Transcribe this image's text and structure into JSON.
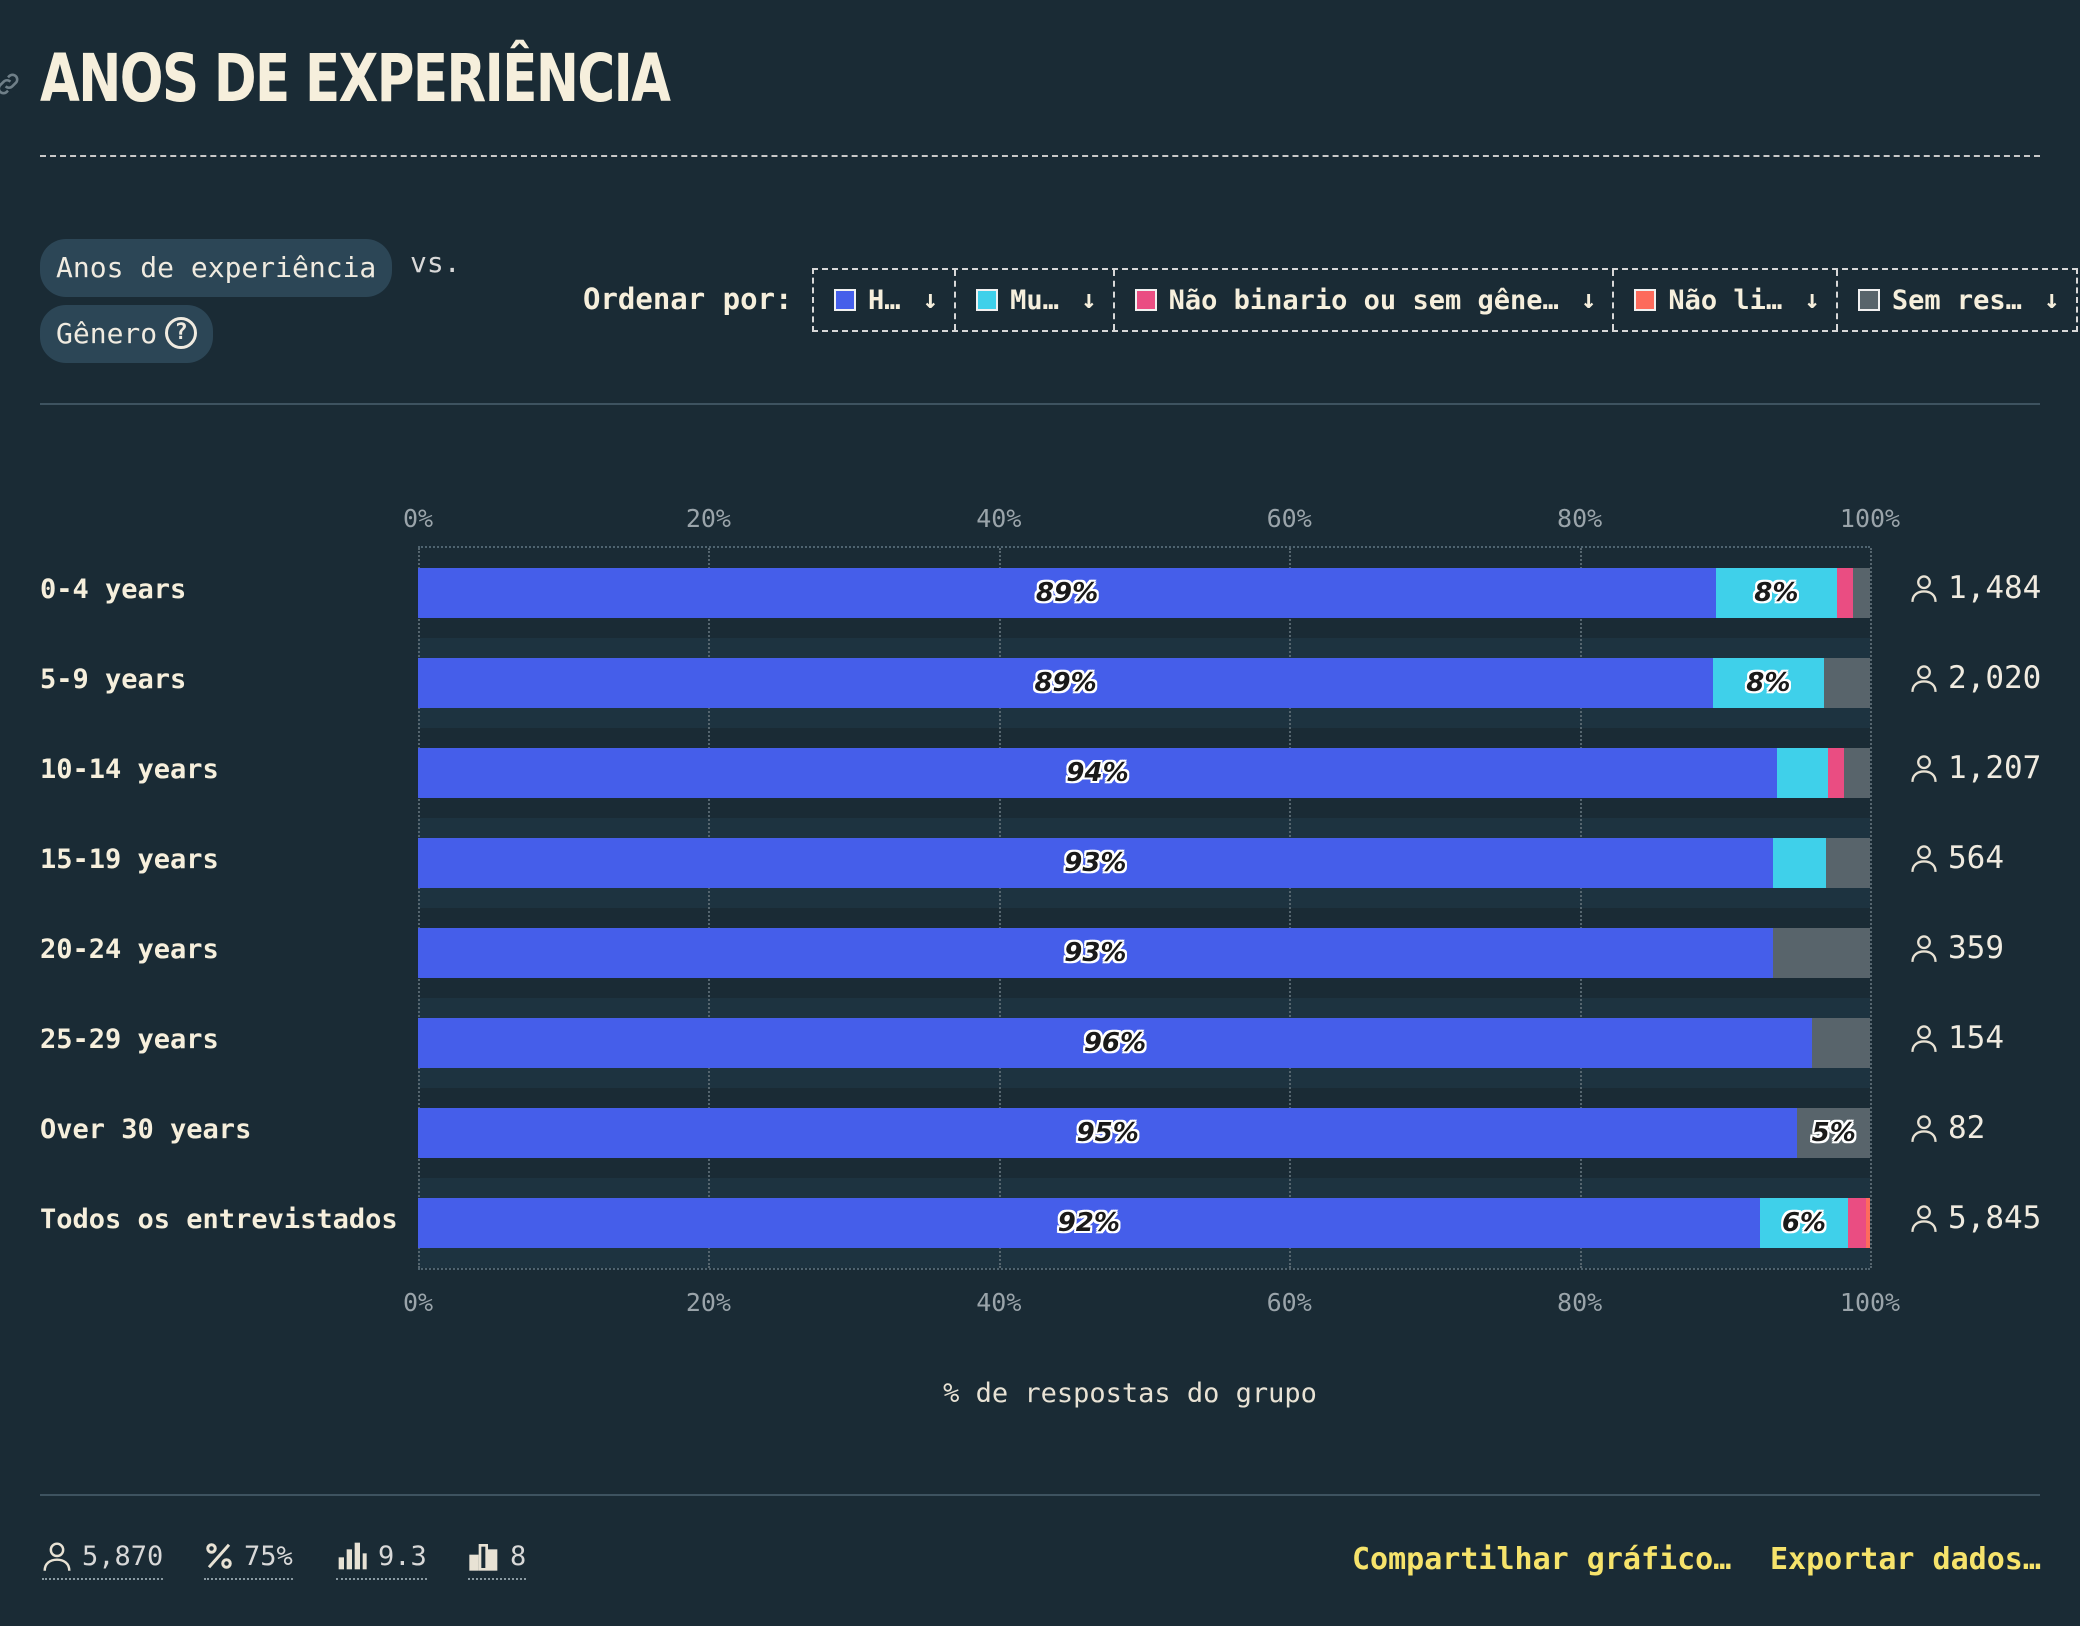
{
  "title": "ANOS DE EXPERIÊNCIA",
  "controls": {
    "question_pill": "Anos de experiência",
    "vs_label": "vs.",
    "compare_pill": "Gênero",
    "help_glyph": "?",
    "sort_label": "Ordenar por:",
    "sort_options": [
      {
        "label": "H…",
        "color": "#455eea",
        "arrow": "↓"
      },
      {
        "label": "Mu…",
        "color": "#3fd0ea",
        "arrow": "↓"
      },
      {
        "label": "Não binario ou sem gêne…",
        "color": "#ea4d82",
        "arrow": "↓"
      },
      {
        "label": "Não li…",
        "color": "#fd6b5c",
        "arrow": "↓"
      },
      {
        "label": "Sem res…",
        "color": "#58646b",
        "arrow": "↓"
      }
    ]
  },
  "chart_data": {
    "type": "bar",
    "orientation": "horizontal",
    "stacked": true,
    "xlabel": "% de respostas do grupo",
    "xlim": [
      0,
      100
    ],
    "xticks": [
      "0%",
      "20%",
      "40%",
      "60%",
      "80%",
      "100%"
    ],
    "categories": [
      "0-4 years",
      "5-9 years",
      "10-14 years",
      "15-19 years",
      "20-24 years",
      "25-29 years",
      "Over 30 years",
      "Todos os entrevistados"
    ],
    "counts": [
      "1,484",
      "2,020",
      "1,207",
      "564",
      "359",
      "154",
      "82",
      "5,845"
    ],
    "series": [
      {
        "color": "#455eea",
        "values": [
          89.4,
          89.2,
          93.6,
          93.3,
          93.3,
          96.0,
          95.0,
          92.4
        ],
        "labels": [
          "89%",
          "89%",
          "94%",
          "93%",
          "93%",
          "96%",
          "95%",
          "92%"
        ]
      },
      {
        "color": "#3fd0ea",
        "values": [
          8.3,
          7.6,
          3.5,
          3.7,
          0,
          0,
          0,
          6.1
        ],
        "labels": [
          "8%",
          "8%",
          "",
          "",
          "",
          "",
          "",
          "6%"
        ]
      },
      {
        "color": "#ea4d82",
        "values": [
          1.1,
          0,
          1.1,
          0,
          0,
          0,
          0,
          1.2
        ],
        "labels": [
          "",
          "",
          "",
          "",
          "",
          "",
          "",
          ""
        ]
      },
      {
        "color": "#fd6b5c",
        "values": [
          0,
          0,
          0,
          0,
          0,
          0,
          0,
          0.3
        ],
        "labels": [
          "",
          "",
          "",
          "",
          "",
          "",
          "",
          ""
        ]
      },
      {
        "color": "#58646b",
        "values": [
          1.2,
          3.2,
          1.8,
          3.0,
          6.7,
          4.0,
          5.0,
          0
        ],
        "labels": [
          "",
          "",
          "",
          "",
          "",
          "",
          "5%",
          ""
        ]
      }
    ]
  },
  "footer": {
    "respondents": "5,870",
    "percent": "75%",
    "mean": "9.3",
    "bins": "8",
    "share_link": "Compartilhar gráfico…",
    "export_link": "Exportar dados…"
  }
}
